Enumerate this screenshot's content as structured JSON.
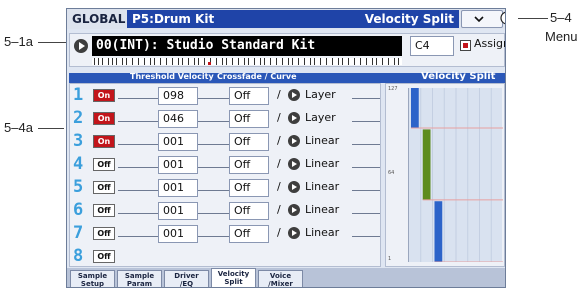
{
  "callouts": {
    "kit": "5–1a",
    "rows": "5–4a",
    "page": "5–4",
    "menu": "Menu"
  },
  "header": {
    "mode": "GLOBAL",
    "page": "P5:Drum Kit",
    "page_tab": "Velocity Split"
  },
  "kit": {
    "name": "00(INT): Studio Standard Kit",
    "key": "C4",
    "assign_label": "Assign",
    "assign_checked": true
  },
  "table": {
    "threshold_header": "Threshold Velocity",
    "crossfade_header": "Crossfade / Curve",
    "graph_header": "Velocity Split",
    "rows": [
      {
        "num": "1",
        "state": "On",
        "threshold": "098",
        "crossfade": "Off",
        "slash": "/",
        "curve": "Layer"
      },
      {
        "num": "2",
        "state": "On",
        "threshold": "046",
        "crossfade": "Off",
        "slash": "/",
        "curve": "Layer"
      },
      {
        "num": "3",
        "state": "On",
        "threshold": "001",
        "crossfade": "Off",
        "slash": "/",
        "curve": "Linear"
      },
      {
        "num": "4",
        "state": "Off",
        "threshold": "001",
        "crossfade": "Off",
        "slash": "/",
        "curve": "Linear"
      },
      {
        "num": "5",
        "state": "Off",
        "threshold": "001",
        "crossfade": "Off",
        "slash": "/",
        "curve": "Linear"
      },
      {
        "num": "6",
        "state": "Off",
        "threshold": "001",
        "crossfade": "Off",
        "slash": "/",
        "curve": "Linear"
      },
      {
        "num": "7",
        "state": "Off",
        "threshold": "001",
        "crossfade": "Off",
        "slash": "/",
        "curve": "Linear"
      },
      {
        "num": "8",
        "state": "Off",
        "threshold": null,
        "crossfade": null,
        "slash": null,
        "curve": null
      }
    ]
  },
  "graph": {
    "ticks": [
      "127",
      "64",
      "1"
    ],
    "bars": [
      {
        "layer": 1,
        "from": 98,
        "to": 127,
        "color": "#2c63c9"
      },
      {
        "layer": 2,
        "from": 46,
        "to": 97,
        "color": "#5d8c1e"
      },
      {
        "layer": 3,
        "from": 1,
        "to": 45,
        "color": "#2c63c9"
      }
    ]
  },
  "tabs": [
    {
      "line1": "Sample",
      "line2": "Setup",
      "active": false
    },
    {
      "line1": "Sample",
      "line2": "Param",
      "active": false
    },
    {
      "line1": "Driver",
      "line2": "/EQ",
      "active": false
    },
    {
      "line1": "Velocity",
      "line2": "Split",
      "active": true
    },
    {
      "line1": "Voice",
      "line2": "/Mixer",
      "active": false
    }
  ]
}
